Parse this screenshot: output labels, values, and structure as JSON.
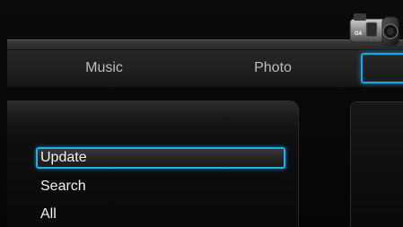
{
  "nav": {
    "tabs": [
      {
        "label": "Music"
      },
      {
        "label": "Photo"
      },
      {
        "label": ""
      }
    ],
    "selected_tab_icon": "video-camera-icon",
    "camera_badge": "G4"
  },
  "menu": {
    "items": [
      {
        "label": "Update",
        "selected": true
      },
      {
        "label": "Search",
        "selected": false
      },
      {
        "label": "All",
        "selected": false
      }
    ]
  },
  "colors": {
    "accent": "#1aa6e0",
    "text": "#f2f2f2",
    "tab_text": "#bdbdbd",
    "background": "#050505"
  }
}
